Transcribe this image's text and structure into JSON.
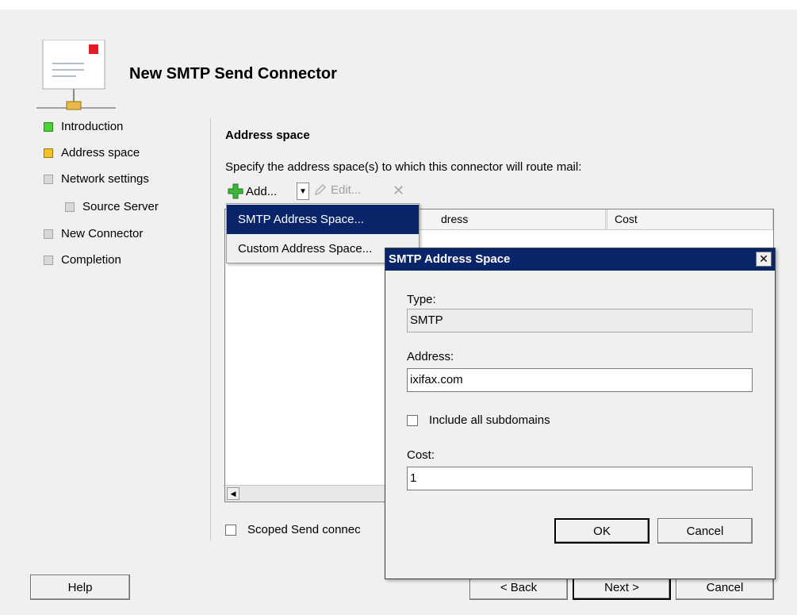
{
  "header": {
    "title": "New SMTP Send Connector",
    "icon": "mail-connector-icon"
  },
  "steps": [
    {
      "label": "Introduction",
      "status": "green"
    },
    {
      "label": "Address space",
      "status": "yellow"
    },
    {
      "label": "Network settings",
      "status": "gray"
    },
    {
      "label": "Source Server",
      "status": "gray"
    },
    {
      "label": "New Connector",
      "status": "gray"
    },
    {
      "label": "Completion",
      "status": "gray"
    }
  ],
  "main": {
    "section_title": "Address space",
    "instruction": "Specify the address space(s) to which this connector will route mail:",
    "toolbar": {
      "add_label": "Add...",
      "edit_label": "Edit...",
      "remove_icon": "x-icon"
    },
    "columns": [
      "dress",
      "Cost"
    ],
    "menu": [
      "SMTP Address Space...",
      "Custom Address Space..."
    ],
    "scoped_label": "Scoped Send connec"
  },
  "footer": {
    "help": "Help",
    "back": "< Back",
    "next": "Next >",
    "cancel": "Cancel"
  },
  "dialog": {
    "title": "SMTP Address Space",
    "type_label": "Type:",
    "type_value": "SMTP",
    "address_label": "Address:",
    "address_value": "ixifax.com",
    "subdomains_label": "Include all subdomains",
    "cost_label": "Cost:",
    "cost_value": "1",
    "ok": "OK",
    "cancel": "Cancel"
  }
}
